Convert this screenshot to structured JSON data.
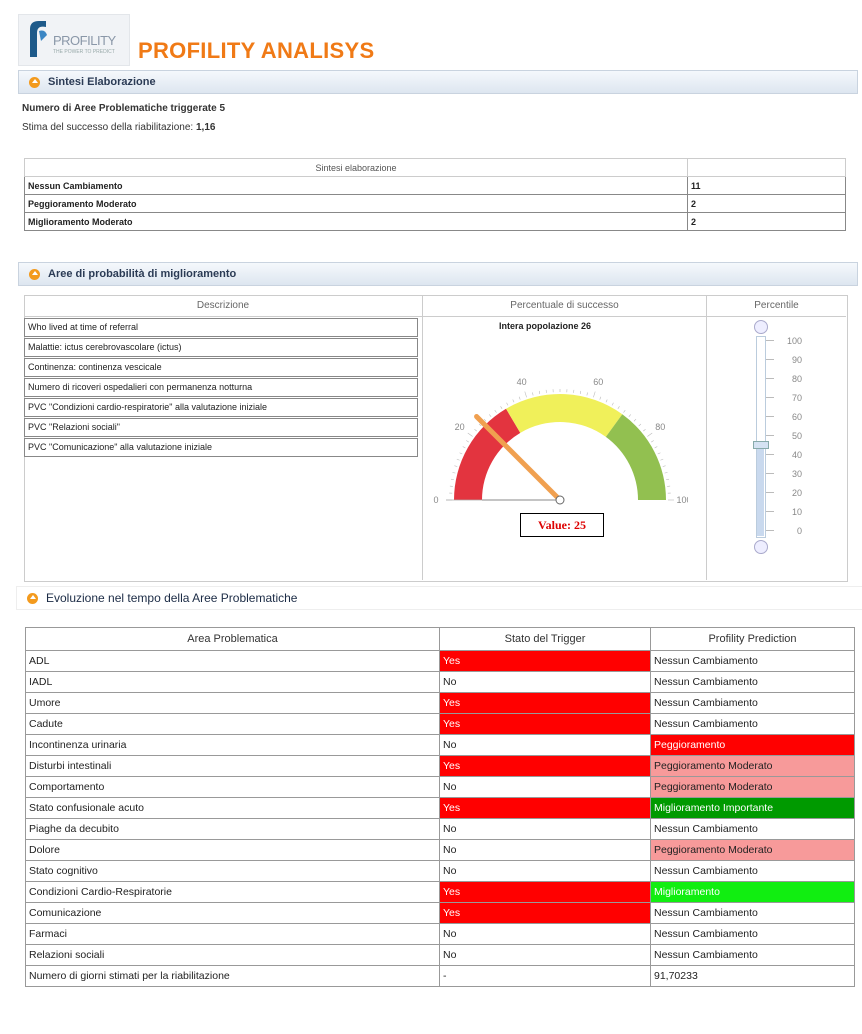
{
  "header": {
    "logo_text": "PROFILITY",
    "logo_sub": "THE POWER TO PREDICT",
    "title": "PROFILITY ANALISYS"
  },
  "sintesi": {
    "panel_title": "Sintesi Elaborazione",
    "line1_label": "Numero di Aree Problematiche triggerate",
    "line1_value": "5",
    "line2_label": "Stima del successo della riabilitazione:",
    "line2_value": "1,16",
    "table_header": "Sintesi elaborazione",
    "rows": [
      {
        "label": "Nessun Cambiamento",
        "value": "11"
      },
      {
        "label": "Peggioramento Moderato",
        "value": "2"
      },
      {
        "label": "Miglioramento Moderato",
        "value": "2"
      }
    ]
  },
  "aree": {
    "panel_title": "Aree di probabilità di miglioramento",
    "col_desc": "Descrizione",
    "col_perc": "Percentuale di successo",
    "col_pctile": "Percentile",
    "items": [
      "Who lived at time of referral",
      "Malattie: ictus cerebrovascolare (ictus)",
      "Continenza: continenza vescicale",
      "Numero di ricoveri ospedalieri con permanenza notturna",
      "PVC \"Condizioni cardio-respiratorie\" alla valutazione iniziale",
      "PVC \"Relazioni sociali\"",
      "PVC \"Comunicazione\" alla valutazione iniziale"
    ],
    "gauge": {
      "title": "Intera popolazione 26",
      "value": 25,
      "value_label": "Value: 25",
      "tick_labels": [
        "0",
        "20",
        "40",
        "60",
        "80",
        "100"
      ],
      "band_colors": [
        "#e3343f",
        "#f0f05a",
        "#92c050"
      ]
    },
    "slider": {
      "labels": [
        "100",
        "90",
        "80",
        "70",
        "60",
        "50",
        "40",
        "30",
        "20",
        "10",
        "0"
      ],
      "value": 45
    }
  },
  "evoluzione": {
    "panel_title": "Evoluzione nel tempo della Aree Problematiche",
    "headers": [
      "Area Problematica",
      "Stato del Trigger",
      "Profility Prediction"
    ],
    "rows": [
      {
        "area": "ADL",
        "trigger": "Yes",
        "pred": "Nessun Cambiamento"
      },
      {
        "area": "IADL",
        "trigger": "No",
        "pred": "Nessun Cambiamento"
      },
      {
        "area": "Umore",
        "trigger": "Yes",
        "pred": "Nessun Cambiamento"
      },
      {
        "area": "Cadute",
        "trigger": "Yes",
        "pred": "Nessun Cambiamento"
      },
      {
        "area": "Incontinenza urinaria",
        "trigger": "No",
        "pred": "Peggioramento"
      },
      {
        "area": "Disturbi intestinali",
        "trigger": "Yes",
        "pred": "Peggioramento Moderato"
      },
      {
        "area": "Comportamento",
        "trigger": "No",
        "pred": "Peggioramento Moderato"
      },
      {
        "area": "Stato confusionale acuto",
        "trigger": "Yes",
        "pred": "Miglioramento Importante"
      },
      {
        "area": "Piaghe da decubito",
        "trigger": "No",
        "pred": "Nessun Cambiamento"
      },
      {
        "area": "Dolore",
        "trigger": "No",
        "pred": "Peggioramento Moderato"
      },
      {
        "area": "Stato cognitivo",
        "trigger": "No",
        "pred": "Nessun Cambiamento"
      },
      {
        "area": "Condizioni Cardio-Respiratorie",
        "trigger": "Yes",
        "pred": "Miglioramento"
      },
      {
        "area": "Comunicazione",
        "trigger": "Yes",
        "pred": "Nessun Cambiamento"
      },
      {
        "area": "Farmaci",
        "trigger": "No",
        "pred": "Nessun Cambiamento"
      },
      {
        "area": "Relazioni sociali",
        "trigger": "No",
        "pred": "Nessun Cambiamento"
      },
      {
        "area": "Numero di giorni stimati per la riabilitazione",
        "trigger": "-",
        "pred": "91,70233"
      }
    ]
  }
}
